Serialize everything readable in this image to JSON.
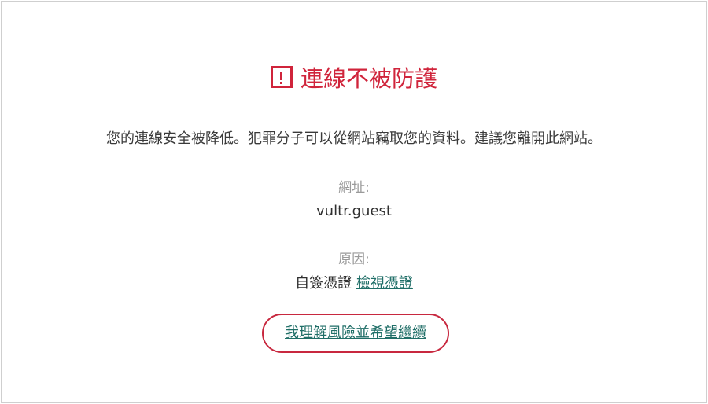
{
  "page": {
    "title": "連線不被防護",
    "message": "您的連線安全被降低。犯罪分子可以從網站竊取您的資料。建議您離開此網站。",
    "url_label": "網址:",
    "url_value": "vultr.guest",
    "reason_label": "原因:",
    "reason_value": "自簽憑證",
    "view_certificate_link": "檢視憑證",
    "proceed_link": "我理解風險並希望繼續"
  },
  "icons": {
    "warning": "exclamation-box-icon"
  },
  "colors": {
    "title": "#d0243b",
    "link": "#1f6e67",
    "highlight_outline": "#c8283f"
  }
}
